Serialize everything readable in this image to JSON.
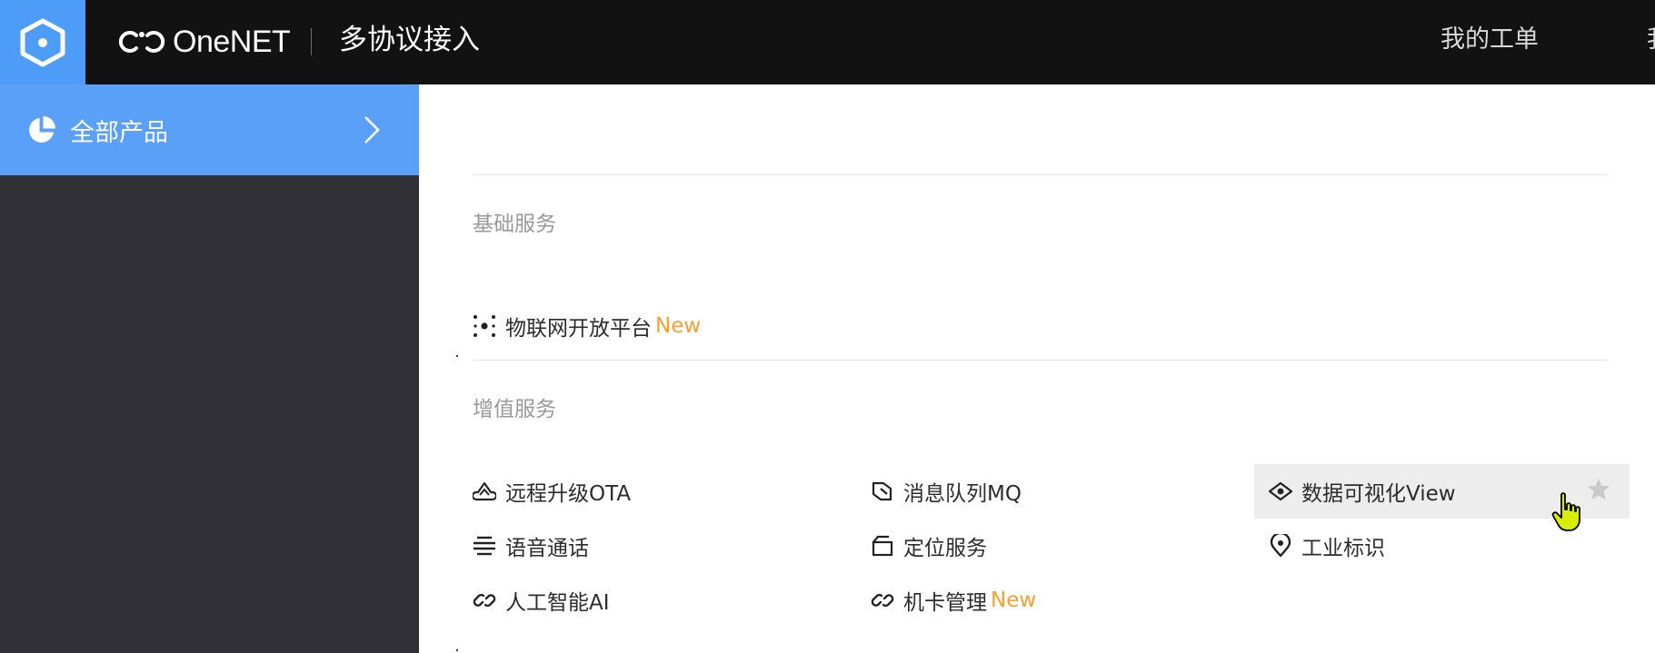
{
  "header": {
    "brand": "OneNET",
    "module_title": "多协议接入",
    "orders_label": "我的工单",
    "cut_label": "我"
  },
  "sidebar": {
    "all_products_label": "全部产品"
  },
  "sections": [
    {
      "title": "基础服务",
      "items": [
        {
          "label": "物联网开放平台",
          "badge": "New",
          "icon": "dots-cluster-icon"
        }
      ]
    },
    {
      "title": "增值服务",
      "items": [
        {
          "label": "远程升级OTA",
          "icon": "cloud-upload-icon"
        },
        {
          "label": "消息队列MQ",
          "icon": "message-queue-icon"
        },
        {
          "label": "数据可视化View",
          "icon": "eye-visual-icon"
        },
        {
          "label": "语音通话",
          "icon": "voice-lines-icon"
        },
        {
          "label": "定位服务",
          "icon": "location-box-icon"
        },
        {
          "label": "工业标识",
          "icon": "map-pin-icon"
        },
        {
          "label": "人工智能AI",
          "icon": "link-icon"
        },
        {
          "label": "机卡管理",
          "badge": "New",
          "icon": "link-icon"
        }
      ]
    }
  ],
  "colors": {
    "topbar": "#121212",
    "accent": "#4d9cf8",
    "sidebar": "#313036",
    "badge_new": "#f5a030"
  }
}
